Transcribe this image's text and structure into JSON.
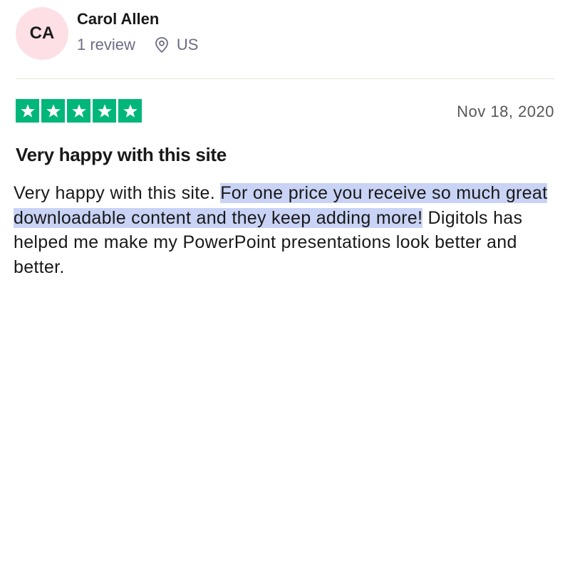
{
  "reviewer": {
    "initials": "CA",
    "name": "Carol Allen",
    "review_count": "1 review",
    "location_icon": "location-pin-icon",
    "country": "US",
    "avatar_color": "#fde0e6"
  },
  "review": {
    "rating": 5,
    "max_rating": 5,
    "star_color": "#00b67a",
    "date": "Nov 18, 2020",
    "title": "Very happy with this site",
    "body_before_selection": "Very happy with this site. ",
    "body_selected": "For one price you receive so much great downloadable content and they keep adding more!",
    "body_after_selection": " Digitols has helped me make my PowerPoint presentations look better and better.",
    "selection_color": "#c9d3f5"
  }
}
